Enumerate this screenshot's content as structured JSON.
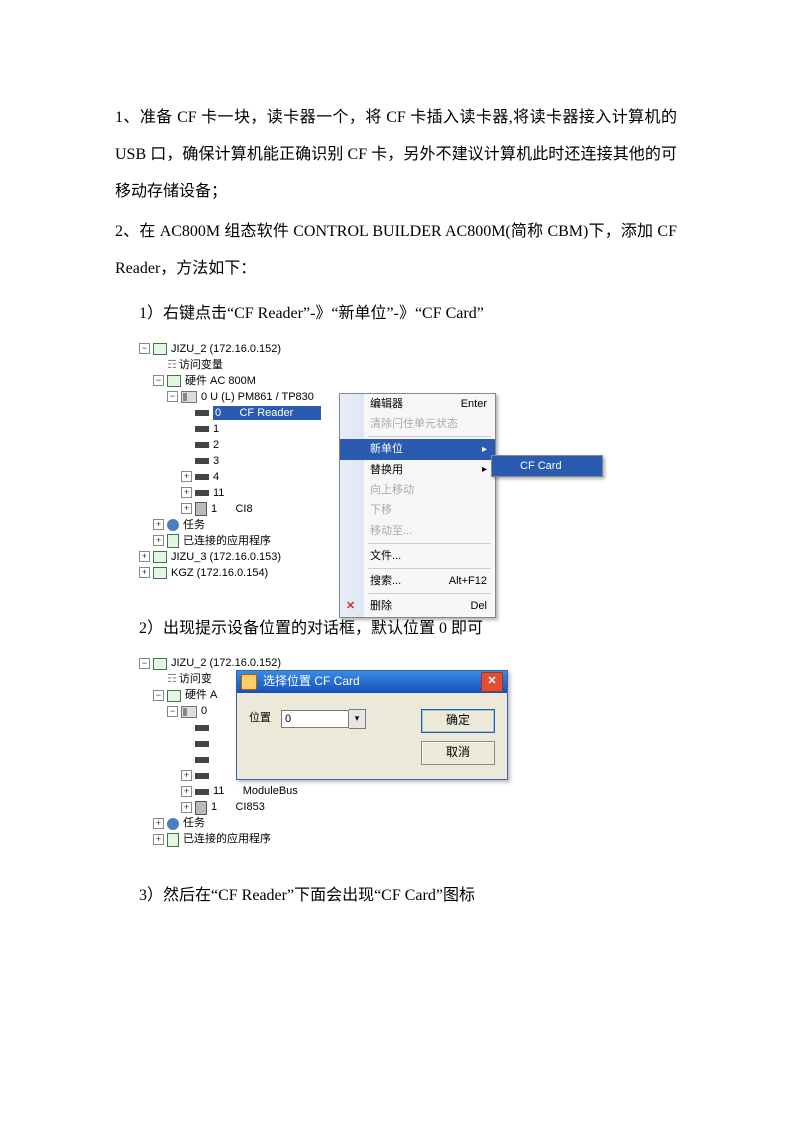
{
  "para1": "1、准备 CF 卡一块，读卡器一个，将 CF 卡插入读卡器,将读卡器接入计算机的 USB 口，确保计算机能正确识别 CF 卡，另外不建议计算机此时还连接其他的可移动存储设备；",
  "para2": "2、在 AC800M 组态软件 CONTROL BUILDER AC800M(简称 CBM)下，添加 CF Reader，方法如下：",
  "step1": "1）右键点击“CF Reader”-》“新单位”-》“CF Card”",
  "step2": "2）出现提示设备位置的对话框，默认位置 0 即可",
  "step3": "3）然后在“CF Reader”下面会出现“CF Card”图标",
  "tree1": {
    "root": "JIZU_2 (172.16.0.152)",
    "n_vars": "访问变量",
    "n_hw": "硬件  AC 800M",
    "n_cpu": "0 U (L)  PM861 / TP830",
    "sel_idx": "0",
    "sel_label": "CF Reader",
    "slots": [
      "1",
      "2",
      "3",
      "4",
      "11"
    ],
    "ci_idx": "1",
    "ci_label": "CI8",
    "n_tasks": "任务",
    "n_apps": "已连接的应用程序",
    "peer1": "JIZU_3 (172.16.0.153)",
    "peer2": "KGZ (172.16.0.154)"
  },
  "menu": {
    "items": [
      {
        "label": "编辑器",
        "accel": "Enter",
        "disabled": false
      },
      {
        "label": "清除闩住单元状态",
        "accel": "",
        "disabled": true
      },
      {
        "sep": true
      },
      {
        "label": "新单位",
        "accel": "",
        "hot": true,
        "arrow": true
      },
      {
        "label": "替换用",
        "accel": "",
        "arrow": true
      },
      {
        "label": "向上移动",
        "accel": "",
        "disabled": true
      },
      {
        "label": "下移",
        "accel": "",
        "disabled": true
      },
      {
        "label": "移动至...",
        "accel": "",
        "disabled": true
      },
      {
        "sep": true
      },
      {
        "label": "文件...",
        "accel": ""
      },
      {
        "sep": true
      },
      {
        "label": "搜索...",
        "accel": "Alt+F12"
      },
      {
        "sep": true
      },
      {
        "label": "删除",
        "accel": "Del",
        "x": true
      }
    ],
    "sub": "CF Card"
  },
  "tree2": {
    "root": "JIZU_2 (172.16.0.152)",
    "n_vars": "访问变",
    "n_hw": "硬件  A",
    "n_cpu": "0",
    "slots": [
      "",
      "",
      "",
      "",
      "11"
    ],
    "mbus": "ModuleBus",
    "ci_idx": "1",
    "ci_label": "CI853",
    "n_tasks": "任务",
    "n_apps": "已连接的应用程序"
  },
  "dialog": {
    "title": "选择位置 CF Card",
    "pos_label": "位置",
    "pos_value": "0",
    "ok": "确定",
    "cancel": "取消"
  }
}
